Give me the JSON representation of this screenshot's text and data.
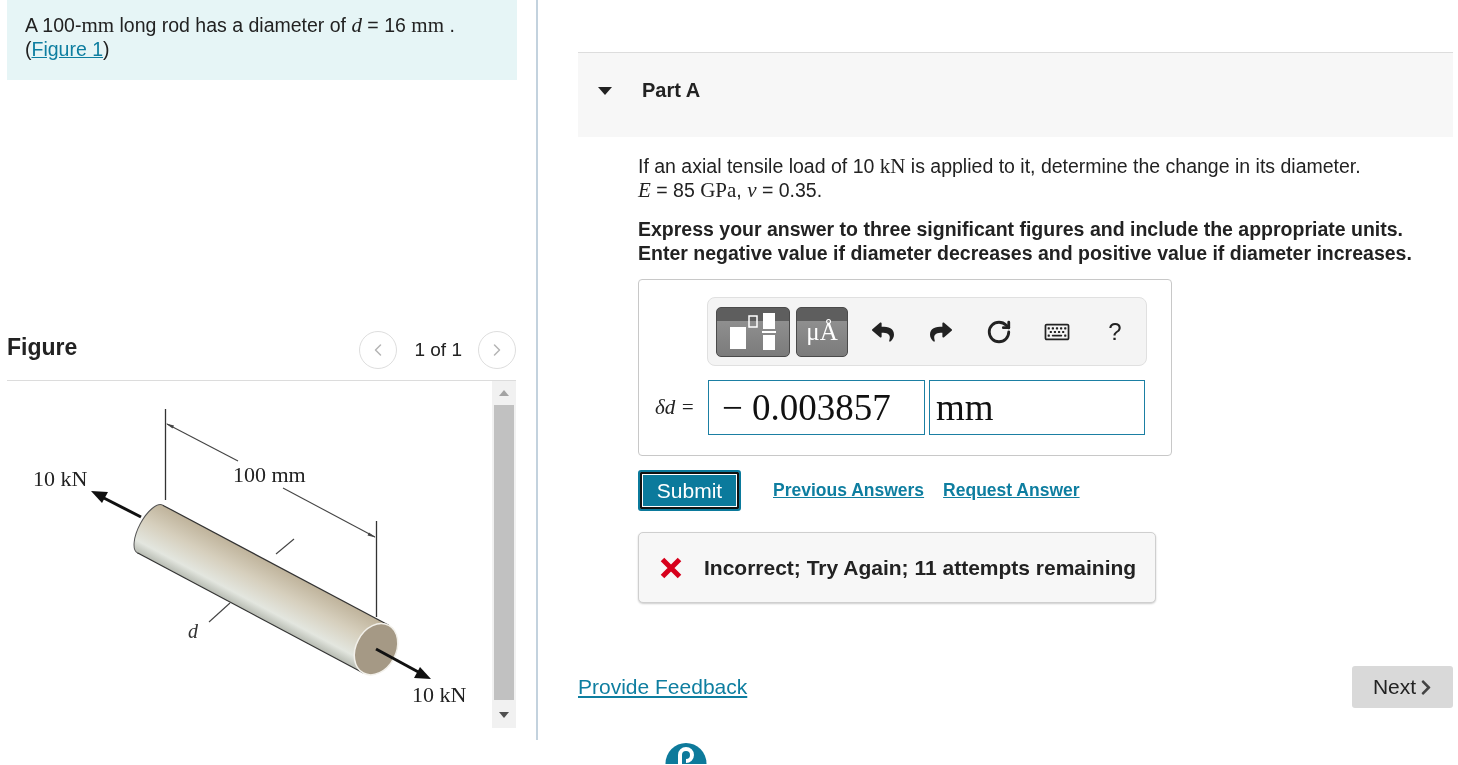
{
  "problem": {
    "segments": [
      {
        "kind": "text",
        "text": "A 100-"
      },
      {
        "kind": "math",
        "text": "mm"
      },
      {
        "kind": "text",
        "text": " long rod has a diameter of "
      },
      {
        "kind": "math-italic",
        "text": "d"
      },
      {
        "kind": "text",
        "text": " = 16 "
      },
      {
        "kind": "math",
        "text": "mm"
      },
      {
        "kind": "text",
        "text": " ."
      },
      {
        "kind": "break"
      },
      {
        "kind": "text",
        "text": "("
      },
      {
        "kind": "link",
        "text": "Figure 1"
      },
      {
        "kind": "text",
        "text": ")"
      }
    ]
  },
  "figure": {
    "title": "Figure",
    "pager": "1 of 1",
    "labels": {
      "left_load": "10 kN",
      "length": "100 mm",
      "diameter": "d",
      "right_load": "10 kN"
    }
  },
  "part": {
    "title": "Part A",
    "expanded": true,
    "question": [
      {
        "kind": "text",
        "text": "If an axial tensile load of 10 "
      },
      {
        "kind": "math",
        "text": "kN"
      },
      {
        "kind": "text",
        "text": " is applied to it, determine the change in its diameter."
      },
      {
        "kind": "break"
      },
      {
        "kind": "math-italic",
        "text": "E"
      },
      {
        "kind": "text",
        "text": " = 85 "
      },
      {
        "kind": "math",
        "text": "GPa"
      },
      {
        "kind": "text",
        "text": ", "
      },
      {
        "kind": "math-italic",
        "text": "v"
      },
      {
        "kind": "text",
        "text": " = 0.35."
      }
    ],
    "instructions": [
      "Express your answer to three significant figures and include the appropriate units.",
      "Enter negative value if diameter decreases and positive value if diameter increases."
    ],
    "toolbar": [
      {
        "kind": "templates"
      },
      {
        "kind": "units",
        "label": "μÅ"
      },
      {
        "kind": "undo"
      },
      {
        "kind": "redo"
      },
      {
        "kind": "reset"
      },
      {
        "kind": "keyboard"
      },
      {
        "kind": "help",
        "label": "?"
      }
    ],
    "answer": {
      "label": "δd =",
      "value": "− 0.003857",
      "unit": "mm"
    },
    "submit": "Submit",
    "links": [
      "Previous Answers",
      "Request Answer"
    ],
    "feedback": {
      "correct": false,
      "message": "Incorrect; Try Again; 11 attempts remaining"
    }
  },
  "footer": {
    "feedback_link": "Provide Feedback",
    "next": "Next"
  }
}
